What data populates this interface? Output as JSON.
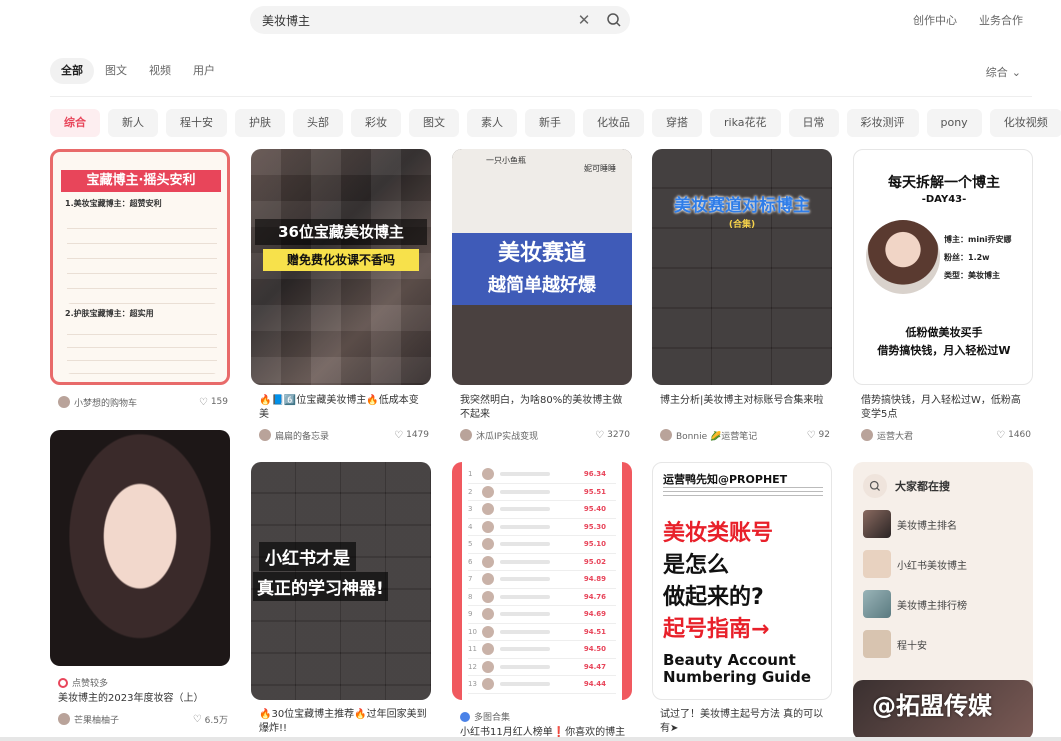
{
  "search": {
    "value": "美妆博主",
    "placeholder": ""
  },
  "header": {
    "links": [
      "创作中心",
      "业务合作"
    ]
  },
  "tabs": [
    {
      "label": "全部",
      "active": true
    },
    {
      "label": "图文"
    },
    {
      "label": "视频"
    },
    {
      "label": "用户"
    }
  ],
  "sort": {
    "label": "综合"
  },
  "chips": [
    "综合",
    "新人",
    "程十安",
    "护肤",
    "头部",
    "彩妆",
    "图文",
    "素人",
    "新手",
    "化妆品",
    "穿搭",
    "rika花花",
    "日常",
    "彩妆测评",
    "pony",
    "化妆视频"
  ],
  "cards": {
    "c1": {
      "cover": [
        "宝藏博主·摇头安利",
        "1.美妆宝藏博主：超赞安利",
        "2.护肤宝藏博主：超实用"
      ],
      "author": "小梦想的购物车",
      "likes": "159"
    },
    "c2": {
      "cover": [
        "36位宝藏美妆博主",
        "赠免费化妆课不香吗"
      ],
      "title": "🔥📘6️⃣位宝藏美妆博主🔥低成本变美",
      "author": "扁扁的备忘录",
      "likes": "1479"
    },
    "c3": {
      "cover": [
        "一只小鱼瓶",
        "妮可睡睡",
        "美妆赛道",
        "越简单越好爆"
      ],
      "title": "我突然明白，为啥80%的美妆博主做不起来",
      "author": "沐瓜IP实战变现",
      "likes": "3270"
    },
    "c4": {
      "cover": [
        "美妆赛道对标博主",
        "(合集)"
      ],
      "title": "博主分析|美妆博主对标账号合集来啦",
      "author": "Bonnie 🌽运营笔记",
      "likes": "92"
    },
    "c5": {
      "cover": [
        "每天拆解一个博主",
        "-DAY43-",
        "博主：mini乔安娜",
        "粉丝：1.2w",
        "类型：美妆博主",
        "低粉做美妆买手",
        "借势搞快钱，月入轻松过W"
      ],
      "title": "借势搞快钱，月入轻松过W，低粉高变学5点",
      "author": "运营大君",
      "likes": "1460"
    },
    "c6": {
      "tag": "点赞较多",
      "title": "美妆博主的2023年度妆容（上）",
      "author": "芒果柚柚子",
      "likes": "6.5万"
    },
    "c7": {
      "cover": [
        "小红书才是",
        "真正的学习神器!"
      ],
      "title": "🔥30位宝藏博主推荐🔥过年回家美到爆炸!!"
    },
    "c8": {
      "tag": "多图合集",
      "title": "小红书11月红人榜单❗你喜欢的博主",
      "scores": [
        "96.34",
        "95.51",
        "95.40",
        "95.30",
        "95.10",
        "95.02",
        "94.89",
        "94.76",
        "94.69",
        "94.51",
        "94.50",
        "94.47",
        "94.44"
      ]
    },
    "c9": {
      "cover": [
        "运营鸭先知@PROPHET",
        "美妆类账号",
        "是怎么",
        "做起来的?",
        "起号指南→",
        "Beauty Account",
        "Numbering Guide"
      ],
      "title": "试过了！美妆博主起号方法 真的可以有➤"
    }
  },
  "trending": {
    "title": "大家都在搜",
    "items": [
      "美妆博主排名",
      "小红书美妆博主",
      "美妆博主排行榜",
      "程十安"
    ]
  },
  "watermark": "@拓盟传媒",
  "colors": {
    "accent": "#e8455a",
    "chip_bg": "#f4f4f4"
  }
}
